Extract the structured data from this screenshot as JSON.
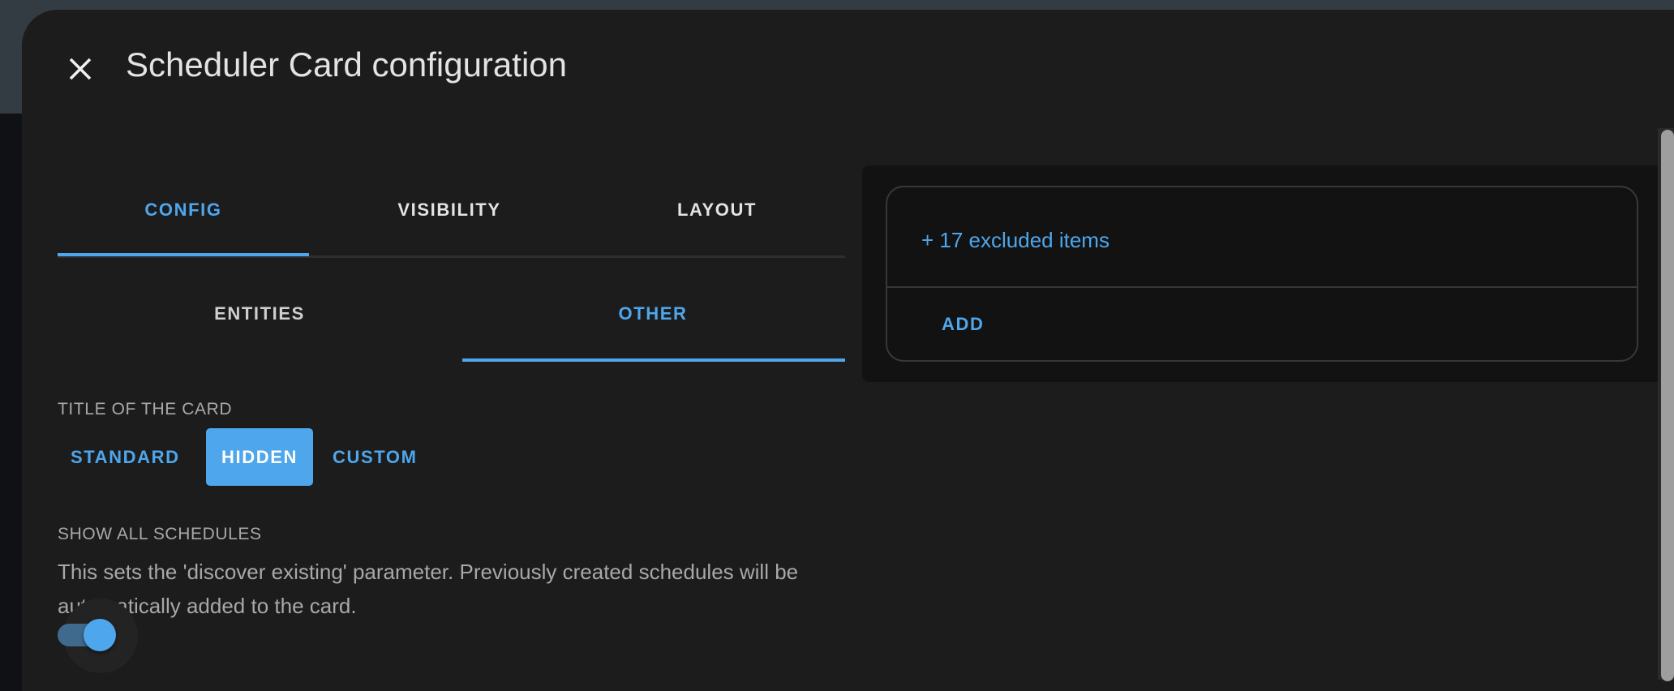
{
  "dialog": {
    "title": "Scheduler Card configuration",
    "close_icon": "close-icon"
  },
  "tabs": [
    {
      "label": "CONFIG",
      "active": true
    },
    {
      "label": "VISIBILITY",
      "active": false
    },
    {
      "label": "LAYOUT",
      "active": false
    }
  ],
  "subtabs": [
    {
      "label": "ENTITIES",
      "active": false
    },
    {
      "label": "OTHER",
      "active": true
    }
  ],
  "title_of_card": {
    "label": "TITLE OF THE CARD",
    "options": [
      "STANDARD",
      "HIDDEN",
      "CUSTOM"
    ],
    "selected": "HIDDEN"
  },
  "show_all": {
    "label": "SHOW ALL SCHEDULES",
    "description": "This sets the 'discover existing' parameter. Previously created schedules will be automatically added to the card.",
    "enabled": true
  },
  "preview": {
    "excluded_text": "+ 17 excluded items",
    "add_label": "ADD"
  },
  "colors": {
    "accent": "#4ea6ec",
    "dialog_bg": "#1c1c1c",
    "text": "#e3e3e3"
  }
}
